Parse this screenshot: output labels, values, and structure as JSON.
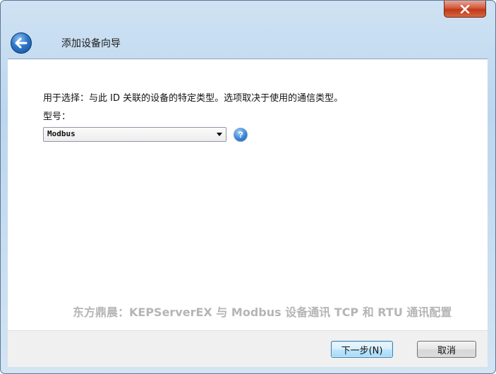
{
  "window": {
    "close_icon": "close-x-icon"
  },
  "header": {
    "back_icon": "back-arrow-icon",
    "title": "添加设备向导"
  },
  "main": {
    "description": "用于选择：与此 ID 关联的设备的特定类型。选项取决于使用的通信类型。",
    "model_label": "型号：",
    "model_select": {
      "value": "Modbus"
    },
    "help_icon": "help-question-icon",
    "help_glyph": "?"
  },
  "watermark": "东方鼎晨：KEPServerEX 与 Modbus 设备通讯 TCP 和 RTU 通讯配置",
  "footer": {
    "next_label": "下一步(N)",
    "cancel_label": "取消"
  },
  "colors": {
    "frame": "#c6dcf0",
    "close_button": "#c1381a",
    "back_button": "#2f77c7",
    "watermark": "#b5b5b5"
  }
}
